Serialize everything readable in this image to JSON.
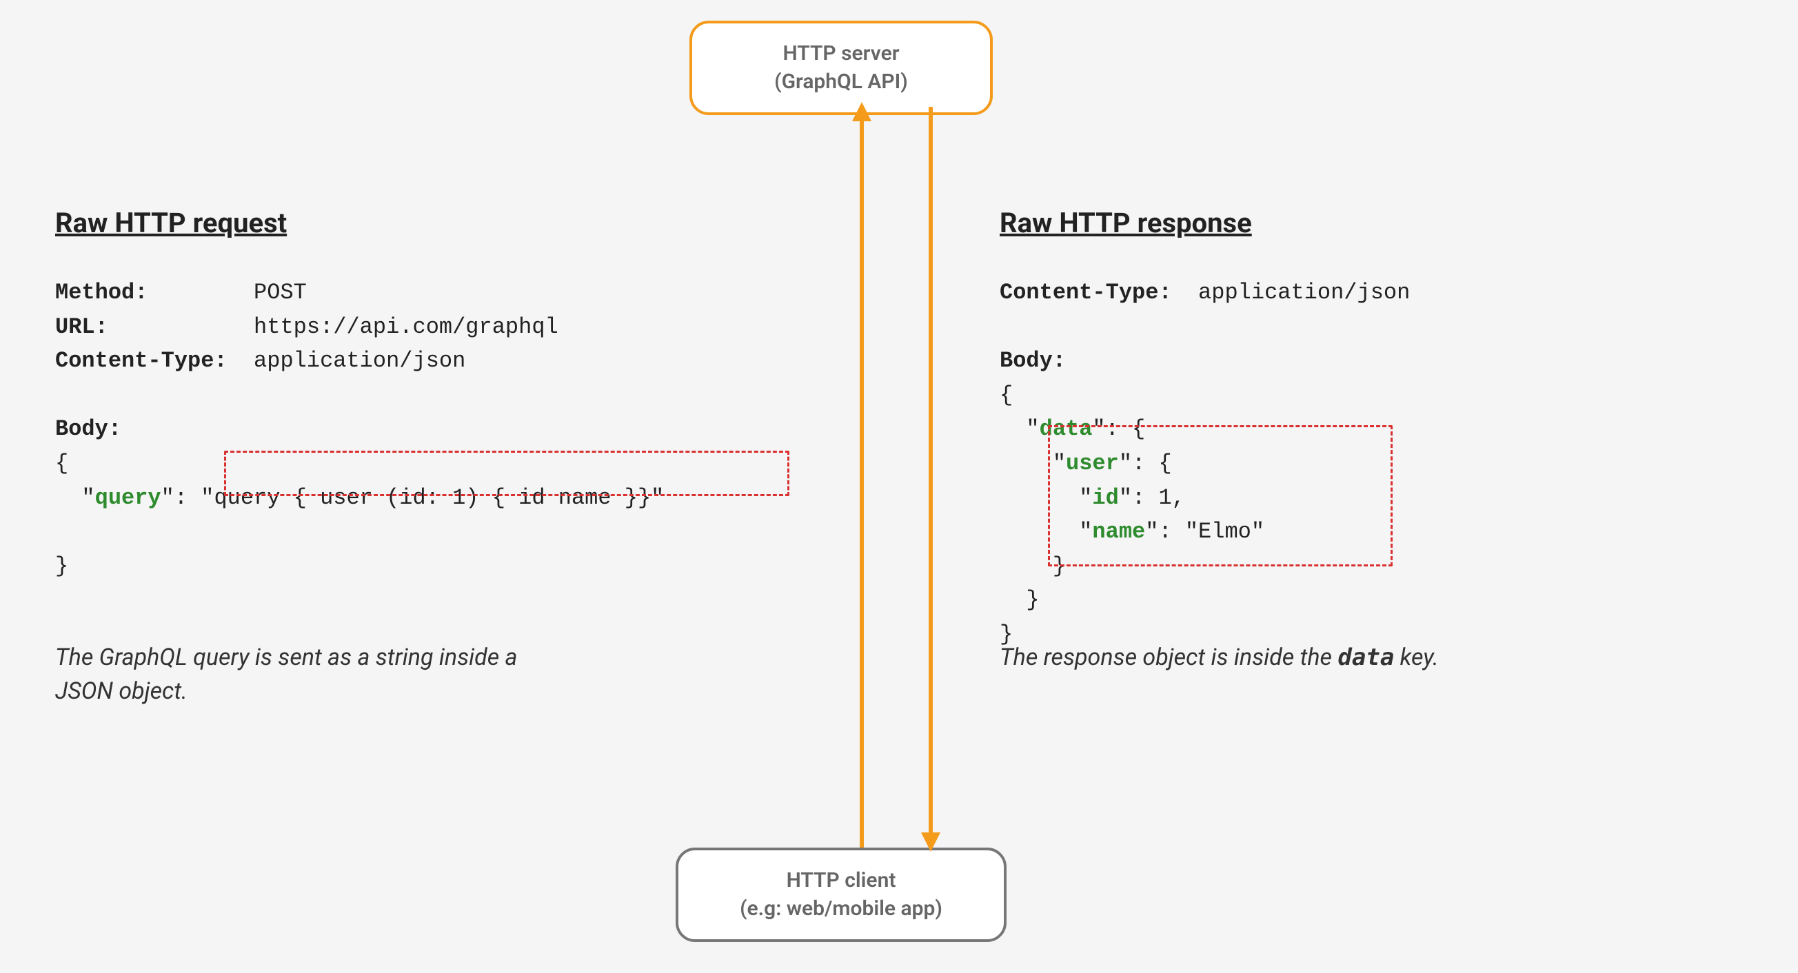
{
  "server": {
    "line1": "HTTP server",
    "line2": "(GraphQL API)"
  },
  "client": {
    "line1": "HTTP client",
    "line2": "(e.g: web/mobile app)"
  },
  "request": {
    "title": "Raw HTTP request",
    "method_label": "Method:",
    "method_value": "POST",
    "url_label": "URL:",
    "url_value": "https://api.com/graphql",
    "ctype_label": "Content-Type:",
    "ctype_value": "application/json",
    "body_label": "Body:",
    "body_open": "{",
    "body_key": "query",
    "body_value": "\"query { user (id: 1) { id name }}\"",
    "body_close": "}",
    "caption": "The GraphQL query is sent as a string inside a JSON object."
  },
  "response": {
    "title": "Raw HTTP response",
    "ctype_label": "Content-Type:",
    "ctype_value": "application/json",
    "body_label": "Body:",
    "body_open": "{",
    "data_key": "data",
    "user_key": "user",
    "id_key": "id",
    "id_value": "1",
    "name_key": "name",
    "name_value": "\"Elmo\"",
    "body_close": "}",
    "caption_prefix": "The response object is inside the ",
    "caption_code": "data",
    "caption_suffix": " key."
  }
}
